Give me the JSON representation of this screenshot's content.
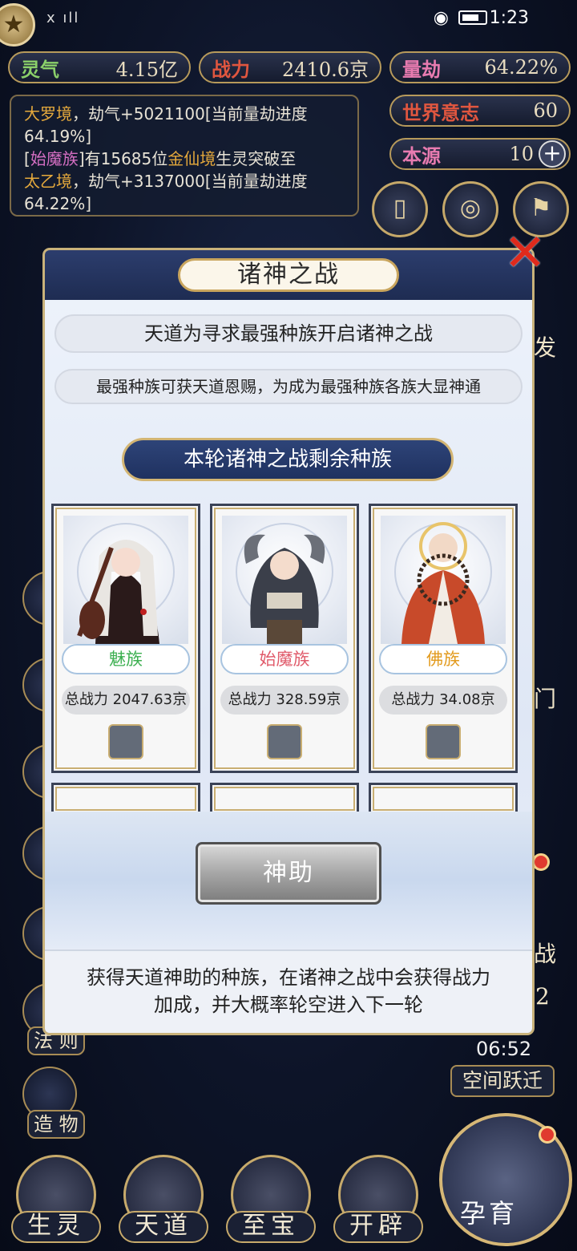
{
  "status_bar": {
    "time": "1:23",
    "signal": "x ıll",
    "wifi_icon": "wifi-icon",
    "eye_icon": "eye-icon",
    "battery_icon": "battery-icon"
  },
  "resources": {
    "lingqi": {
      "label": "灵气",
      "value": "4.15亿"
    },
    "zhanli": {
      "label": "战力",
      "value": "2410.6京"
    },
    "liangjie": {
      "label": "量劫",
      "value": "64.22%"
    },
    "world_will": {
      "label": "世界意志",
      "value": "60"
    },
    "benyuan": {
      "label": "本源",
      "value": "10"
    },
    "plus": "+"
  },
  "log": {
    "line1_a": "大罗境",
    "line1_b": "，劫气+5021100[当前量劫进度64.19%]",
    "line2_a": "[",
    "line2_b": "始魔族",
    "line2_c": "]有15685位",
    "line2_d": "金仙境",
    "line2_e": "生灵突破至",
    "line3_a": "太乙境",
    "line3_b": "，劫气+3137000[当前量劫进度64.22%]"
  },
  "modal": {
    "title": "诸神之战",
    "subtitle": "天道为寻求最强种族开启诸神之战",
    "description": "最强种族可获天道恩赐，为成为最强种族各族大显神通",
    "section_title": "本轮诸神之战剩余种族",
    "races": [
      {
        "name": "魅族",
        "power": "总战力 2047.63京",
        "name_color": "#3caf50"
      },
      {
        "name": "始魔族",
        "power": "总战力 328.59京",
        "name_color": "#e05a6a"
      },
      {
        "name": "佛族",
        "power": "总战力 34.08京",
        "name_color": "#e29a1c"
      }
    ],
    "assist_button": "神助",
    "footer_note_line1": "获得天道神助的种族，在诸神之战中会获得战力",
    "footer_note_line2": "加成，并大概率轮空进入下一轮",
    "close_icon": "close-icon"
  },
  "side_left": {
    "fa_ze": "法 则",
    "zao_wu": "造 物"
  },
  "side_right": {
    "timer": "06:52",
    "space_jump": "空间跃迁",
    "partial_fa": "发",
    "partial_men": "门",
    "partial_2": "2",
    "partial_zhan": "战"
  },
  "bottom_nav": {
    "sheng_ling": "生灵",
    "tian_dao": "天道",
    "zhi_bao": "至宝",
    "kai_pi": "开辟",
    "yun_yu": "孕育"
  }
}
